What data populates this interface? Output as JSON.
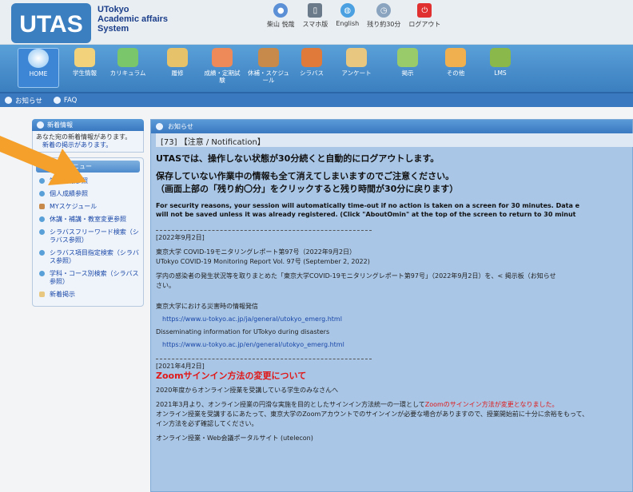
{
  "header": {
    "logo_letters": "UTAS",
    "logo_text": [
      "UTokyo",
      "Academic affairs",
      "System"
    ],
    "links": [
      {
        "label": "柴山 悦哉",
        "icon": "user-icon"
      },
      {
        "label": "スマホ版",
        "icon": "smartphone-icon"
      },
      {
        "label": "English",
        "icon": "globe-icon"
      },
      {
        "label": "残り約30分",
        "icon": "clock-icon"
      },
      {
        "label": "ログアウト",
        "icon": "power-icon"
      }
    ]
  },
  "nav": {
    "items": [
      {
        "label": "HOME",
        "icon": "home-icon"
      },
      {
        "label": "学生情報",
        "icon": "student-info-icon"
      },
      {
        "label": "カリキュラム",
        "icon": "curriculum-icon"
      },
      {
        "label": "履修",
        "icon": "registration-icon"
      },
      {
        "label": "成績・定期試験",
        "icon": "grades-icon"
      },
      {
        "label": "休補・スケジュール",
        "icon": "schedule-icon"
      },
      {
        "label": "シラバス",
        "icon": "syllabus-icon"
      },
      {
        "label": "アンケート",
        "icon": "survey-icon"
      },
      {
        "label": "掲示",
        "icon": "bulletin-icon"
      },
      {
        "label": "その他",
        "icon": "other-icon"
      },
      {
        "label": "LMS",
        "icon": "lms-icon"
      }
    ]
  },
  "subnav": {
    "items": [
      "お知らせ",
      "FAQ"
    ]
  },
  "sidebar": {
    "news_title": "新着情報",
    "news_text1": "あなた宛の新着情報があります。",
    "news_text2": "新着の掲示があります。",
    "menu_title": "よく使うメニュー",
    "menu": [
      "学生情報参照",
      "個人成績参照",
      "MYスケジュール",
      "休講・補講・教室変更参照",
      "シラバスフリーワード検索（シラバス参照）",
      "シラバス項目指定検索（シラバス参照）",
      "学科・コース別検索（シラバス参照）",
      "新着掲示"
    ]
  },
  "main": {
    "title": "お知らせ",
    "notification": "[73] 【注意 / Notification】",
    "warn1": "UTASでは、操作しない状態が30分続くと自動的にログアウトします。",
    "warn2": "保存していない作業中の情報も全て消えてしまいますのでご注意ください。",
    "warn3": "（画面上部の「残り約〇分」をクリックすると残り時間が30分に戻ります）",
    "en1": "For security reasons, your session will automatically time-out if no action is taken on a screen for 30 minutes. Data e",
    "en2": "will not be saved unless it was already registered. (Click \"AboutOmin\" at the top of the screen to return to 30 minut",
    "date1": "[2022年9月2日]",
    "report_ja": "東京大学 COVID-19モニタリングレポート第97号（2022年9月2日）",
    "report_en": "UTokyo COVID-19 Monitoring Report Vol. 97号 (September 2, 2022)",
    "report_desc": "学内の感染者の発生状況等を取りまとめた「東京大学COVID-19モニタリングレポート第97号」（2022年9月2日）を、< 掲示板（お知らせ",
    "report_desc2": "さい。",
    "disaster_ja": "東京大学における災害時の情報発信",
    "link_ja": "https://www.u-tokyo.ac.jp/ja/general/utokyo_emerg.html",
    "disaster_en": "Disseminating information for UTokyo during disasters",
    "link_en": "https://www.u-tokyo.ac.jp/en/general/utokyo_emerg.html",
    "date2": "[2021年4月2日]",
    "zoom_title": "Zoomサインイン方法の変更について",
    "zoom_p1": "2020年度からオンライン授業を受講している学生のみなさんへ",
    "zoom_p2a": "2021年3月より、オンライン授業の円滑な実施を目的としたサインイン方法統一の一環として",
    "zoom_p2b": "Zoomのサインイン方法が変更となりました。",
    "zoom_p3": "オンライン授業を受講するにあたって、東京大学のZoomアカウントでのサインインが必要な場合がありますので、授業開始前に十分に余裕をもって、",
    "zoom_p4": "イン方法を必ず確認してください。",
    "portal": "オンライン授業・Web会議ポータルサイト (utelecon)"
  },
  "colors": {
    "accent": "#3a78c0",
    "warning_red": "#e01818",
    "arrow": "#f5a02a"
  }
}
